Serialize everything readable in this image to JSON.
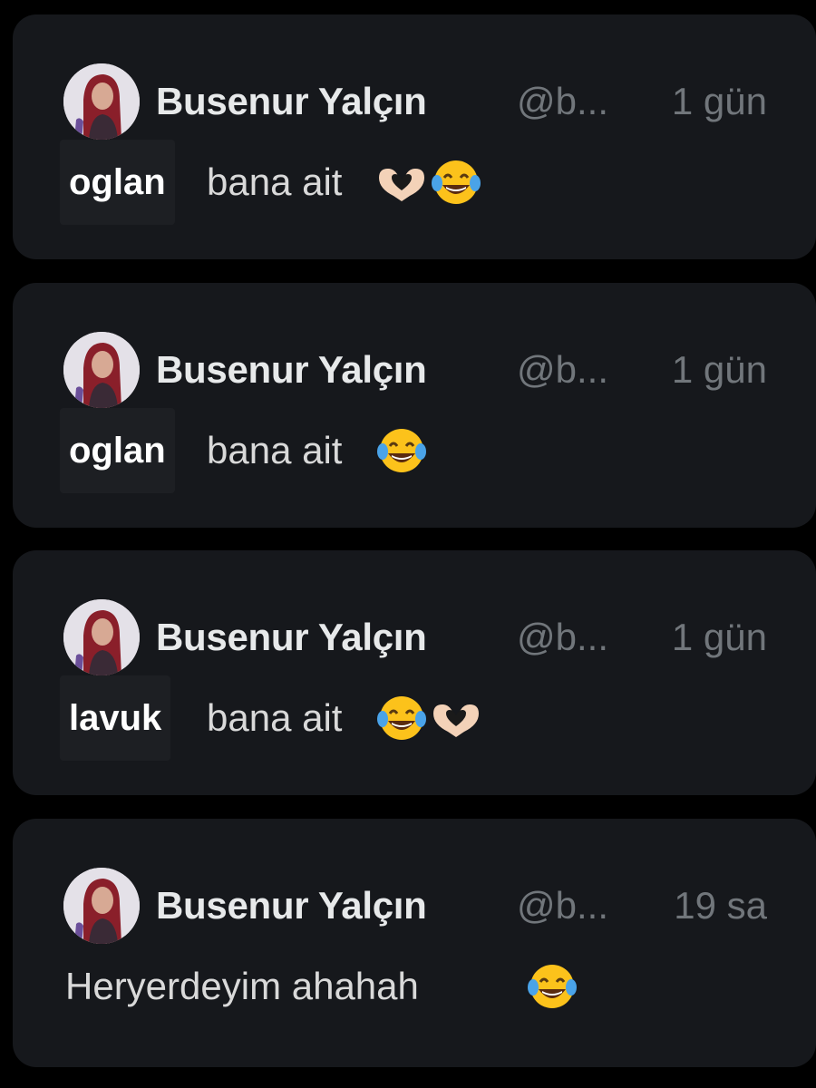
{
  "colors": {
    "background": "#000000",
    "card": "#16181c",
    "name": "#e7e9ea",
    "muted": "#71767b",
    "highlight": "#1d1f23"
  },
  "tweets": [
    {
      "author": "Busenur Yalçın",
      "handle": "@b...",
      "time": "1 gün",
      "highlight": "oglan",
      "text": "bana ait",
      "emojis": [
        "heart-hands-icon",
        "tears-of-joy-icon"
      ]
    },
    {
      "author": "Busenur Yalçın",
      "handle": "@b...",
      "time": "1 gün",
      "highlight": "oglan",
      "text": "bana ait",
      "emojis": [
        "tears-of-joy-icon"
      ]
    },
    {
      "author": "Busenur Yalçın",
      "handle": "@b...",
      "time": "1 gün",
      "highlight": "lavuk",
      "text": "bana ait",
      "emojis": [
        "tears-of-joy-icon",
        "heart-hands-icon"
      ]
    },
    {
      "author": "Busenur Yalçın",
      "handle": "@b...",
      "time": "19 sa",
      "highlight": "",
      "text": "Heryerdeyim ahahah",
      "emojis": [
        "tears-of-joy-icon"
      ]
    }
  ]
}
